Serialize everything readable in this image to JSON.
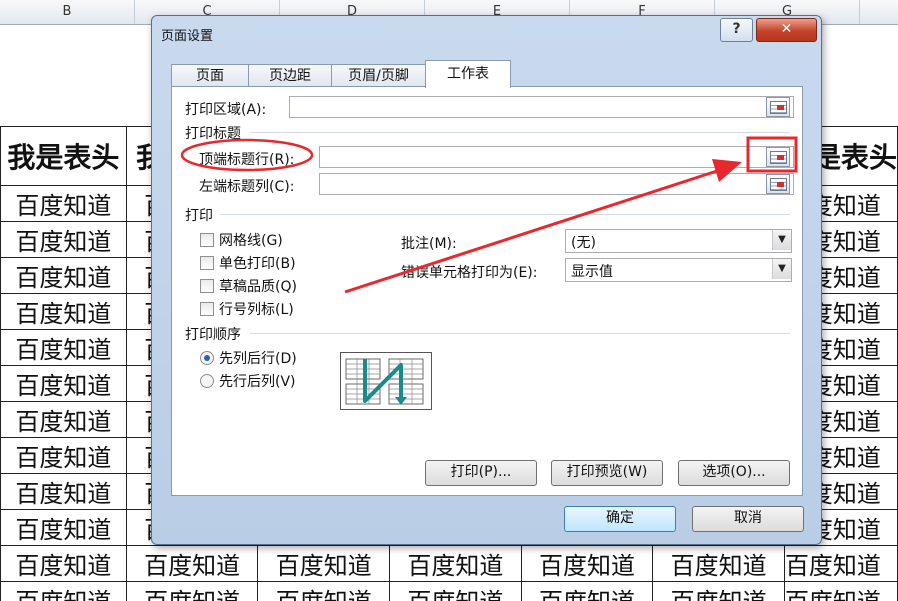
{
  "sheet": {
    "columns": [
      "B",
      "C",
      "D",
      "E",
      "F",
      "G"
    ],
    "header_text": "我是表头",
    "row_text": "百度知道",
    "row_count": 12
  },
  "dialog": {
    "title": "页面设置",
    "help_glyph": "?",
    "close_glyph": "✕",
    "tabs": [
      "页面",
      "页边距",
      "页眉/页脚",
      "工作表"
    ],
    "active_tab": "工作表",
    "print_area_label": "打印区域(A):",
    "print_area_value": "",
    "print_titles_section": "打印标题",
    "top_rows_label": "顶端标题行(R):",
    "top_rows_value": "",
    "left_cols_label": "左端标题列(C):",
    "left_cols_value": "",
    "print_section": "打印",
    "checkboxes": [
      "网格线(G)",
      "单色打印(B)",
      "草稿品质(Q)",
      "行号列标(L)"
    ],
    "comments_label": "批注(M):",
    "comments_value": "(无)",
    "cell_errors_label": "错误单元格打印为(E):",
    "cell_errors_value": "显示值",
    "order_section": "打印顺序",
    "order_options": [
      "先列后行(D)",
      "先行后列(V)"
    ],
    "order_selected": 0,
    "buttons": {
      "print": "打印(P)...",
      "preview": "打印预览(W)",
      "options": "选项(O)...",
      "ok": "确定",
      "cancel": "取消"
    }
  },
  "annotation": {
    "color": "#e8282c",
    "target": "top-rows-ref-button"
  }
}
